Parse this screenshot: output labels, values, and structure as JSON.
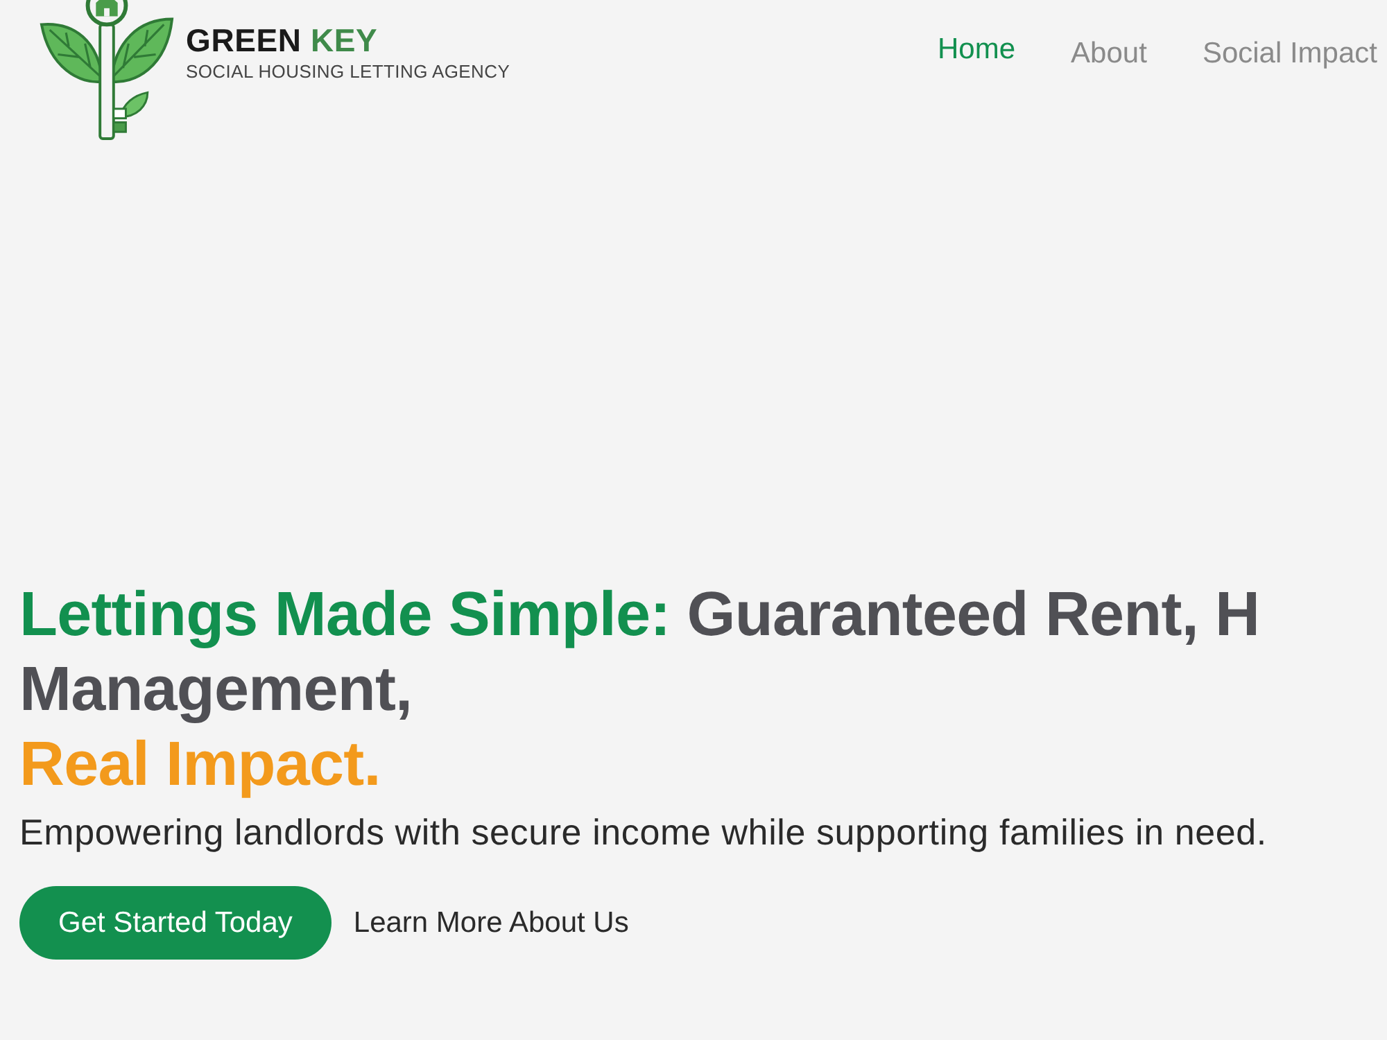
{
  "header": {
    "logo": {
      "name_parts": [
        {
          "text": "GREEN",
          "kind": "plain"
        },
        {
          "text": "KEY",
          "kind": "accent"
        }
      ],
      "tagline": "SOCIAL HOUSING LETTING AGENCY"
    },
    "nav": [
      {
        "label": "Home",
        "selected": true
      },
      {
        "label": "About",
        "selected": false
      },
      {
        "label": "Social Impact",
        "selected": false
      }
    ]
  },
  "hero": {
    "headline_lines": [
      [
        {
          "text": "Lettings Made Simple:",
          "kind": "accent"
        },
        {
          "text": "Guaranteed Rent, H",
          "kind": "plain"
        }
      ],
      [
        {
          "text": "Management,",
          "kind": "plain"
        }
      ],
      [
        {
          "text": "Real Impact.",
          "kind": "highlight"
        }
      ]
    ],
    "subtitle": "Empowering landlords with secure income while supporting families in need.",
    "buttons": [
      {
        "label": "Get Started Today",
        "kind": "primary"
      },
      {
        "label": "Learn More About Us",
        "kind": "link"
      }
    ]
  }
}
